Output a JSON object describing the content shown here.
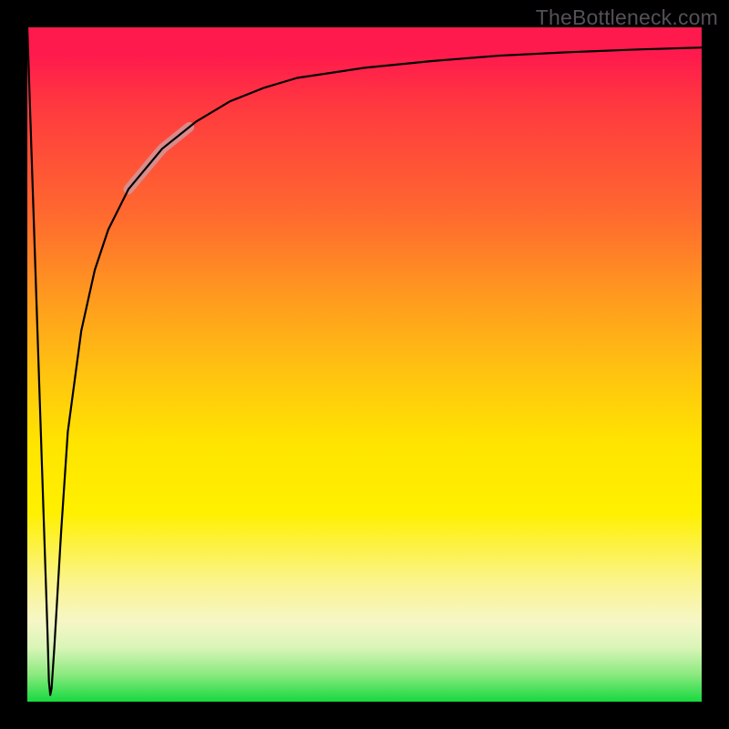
{
  "watermark": "TheBottleneck.com",
  "colors": {
    "frame": "#000000",
    "gradient_top": "#ff1a4d",
    "gradient_bottom": "#17d93f",
    "curve": "#000000",
    "highlight": "#d1969a",
    "watermark": "#565058"
  },
  "chart_data": {
    "type": "line",
    "title": "",
    "xlabel": "",
    "ylabel": "",
    "xlim": [
      0,
      100
    ],
    "ylim": [
      0,
      100
    ],
    "grid": false,
    "legend": false,
    "series": [
      {
        "name": "bottleneck-curve",
        "x": [
          0,
          2,
          3,
          3.2,
          3.4,
          3.6,
          4,
          5,
          6,
          8,
          10,
          12,
          15,
          20,
          25,
          30,
          35,
          40,
          50,
          60,
          70,
          80,
          90,
          100
        ],
        "values": [
          100,
          40,
          10,
          3,
          1,
          2,
          8,
          25,
          40,
          55,
          64,
          70,
          76,
          82,
          86,
          89,
          91,
          92.5,
          94,
          95,
          95.8,
          96.3,
          96.7,
          97
        ]
      }
    ],
    "annotations": [
      {
        "name": "highlight-segment",
        "x_range": [
          15,
          24
        ],
        "note": "thick pale-red overlay on curve"
      }
    ]
  }
}
